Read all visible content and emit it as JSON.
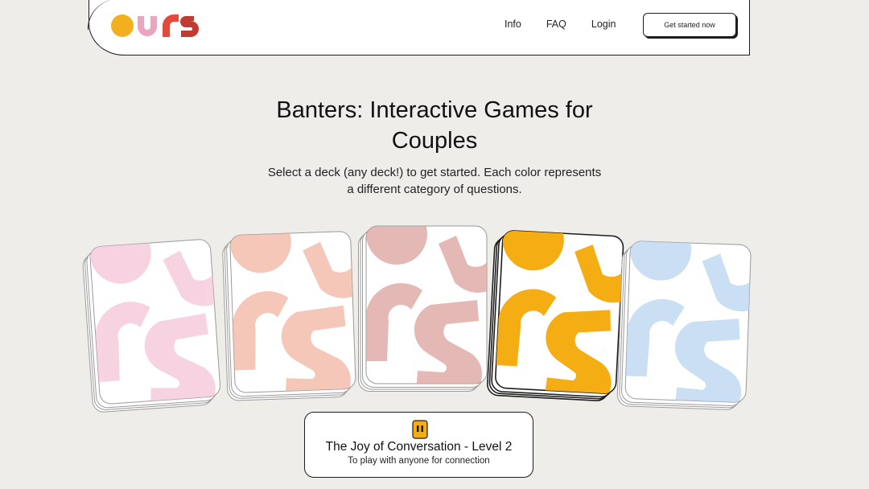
{
  "brand": {
    "logo_text": "ours",
    "colors": [
      "#f2b01e",
      "#e9a6c0",
      "#c23b33"
    ]
  },
  "nav": {
    "links": [
      "Info",
      "FAQ",
      "Login"
    ],
    "cta_label": "Get started now"
  },
  "hero": {
    "title_line1": "Banters: Interactive Games for",
    "title_line2": "Couples",
    "subtitle_line1": "Select a deck (any deck!) to get started. Each color represents",
    "subtitle_line2": "a different category of questions."
  },
  "decks": [
    {
      "color": "#f5c4d8",
      "selected": false
    },
    {
      "color": "#f2b4a1",
      "selected": false
    },
    {
      "color": "#dba09b",
      "selected": false
    },
    {
      "color": "#f5ad14",
      "selected": true
    },
    {
      "color": "#b8d4ef",
      "selected": false
    }
  ],
  "selected_deck": {
    "icon": "deck-icon",
    "title": "The Joy of Conversation - Level 2",
    "description": "To play with anyone for connection"
  }
}
